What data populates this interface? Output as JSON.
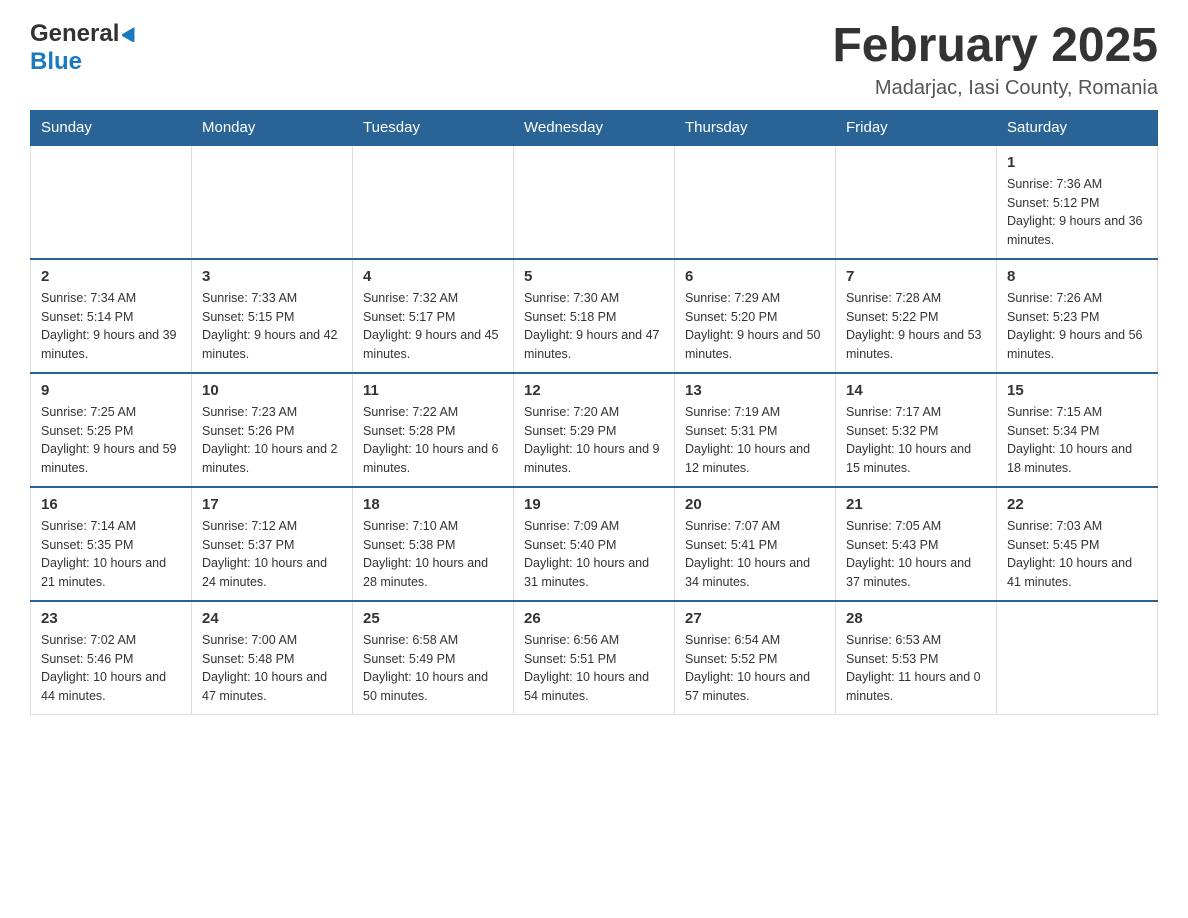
{
  "header": {
    "logo_general": "General",
    "logo_blue": "Blue",
    "month_title": "February 2025",
    "location": "Madarjac, Iasi County, Romania"
  },
  "weekdays": [
    "Sunday",
    "Monday",
    "Tuesday",
    "Wednesday",
    "Thursday",
    "Friday",
    "Saturday"
  ],
  "weeks": [
    [
      {
        "day": "",
        "sunrise": "",
        "sunset": "",
        "daylight": ""
      },
      {
        "day": "",
        "sunrise": "",
        "sunset": "",
        "daylight": ""
      },
      {
        "day": "",
        "sunrise": "",
        "sunset": "",
        "daylight": ""
      },
      {
        "day": "",
        "sunrise": "",
        "sunset": "",
        "daylight": ""
      },
      {
        "day": "",
        "sunrise": "",
        "sunset": "",
        "daylight": ""
      },
      {
        "day": "",
        "sunrise": "",
        "sunset": "",
        "daylight": ""
      },
      {
        "day": "1",
        "sunrise": "Sunrise: 7:36 AM",
        "sunset": "Sunset: 5:12 PM",
        "daylight": "Daylight: 9 hours and 36 minutes."
      }
    ],
    [
      {
        "day": "2",
        "sunrise": "Sunrise: 7:34 AM",
        "sunset": "Sunset: 5:14 PM",
        "daylight": "Daylight: 9 hours and 39 minutes."
      },
      {
        "day": "3",
        "sunrise": "Sunrise: 7:33 AM",
        "sunset": "Sunset: 5:15 PM",
        "daylight": "Daylight: 9 hours and 42 minutes."
      },
      {
        "day": "4",
        "sunrise": "Sunrise: 7:32 AM",
        "sunset": "Sunset: 5:17 PM",
        "daylight": "Daylight: 9 hours and 45 minutes."
      },
      {
        "day": "5",
        "sunrise": "Sunrise: 7:30 AM",
        "sunset": "Sunset: 5:18 PM",
        "daylight": "Daylight: 9 hours and 47 minutes."
      },
      {
        "day": "6",
        "sunrise": "Sunrise: 7:29 AM",
        "sunset": "Sunset: 5:20 PM",
        "daylight": "Daylight: 9 hours and 50 minutes."
      },
      {
        "day": "7",
        "sunrise": "Sunrise: 7:28 AM",
        "sunset": "Sunset: 5:22 PM",
        "daylight": "Daylight: 9 hours and 53 minutes."
      },
      {
        "day": "8",
        "sunrise": "Sunrise: 7:26 AM",
        "sunset": "Sunset: 5:23 PM",
        "daylight": "Daylight: 9 hours and 56 minutes."
      }
    ],
    [
      {
        "day": "9",
        "sunrise": "Sunrise: 7:25 AM",
        "sunset": "Sunset: 5:25 PM",
        "daylight": "Daylight: 9 hours and 59 minutes."
      },
      {
        "day": "10",
        "sunrise": "Sunrise: 7:23 AM",
        "sunset": "Sunset: 5:26 PM",
        "daylight": "Daylight: 10 hours and 2 minutes."
      },
      {
        "day": "11",
        "sunrise": "Sunrise: 7:22 AM",
        "sunset": "Sunset: 5:28 PM",
        "daylight": "Daylight: 10 hours and 6 minutes."
      },
      {
        "day": "12",
        "sunrise": "Sunrise: 7:20 AM",
        "sunset": "Sunset: 5:29 PM",
        "daylight": "Daylight: 10 hours and 9 minutes."
      },
      {
        "day": "13",
        "sunrise": "Sunrise: 7:19 AM",
        "sunset": "Sunset: 5:31 PM",
        "daylight": "Daylight: 10 hours and 12 minutes."
      },
      {
        "day": "14",
        "sunrise": "Sunrise: 7:17 AM",
        "sunset": "Sunset: 5:32 PM",
        "daylight": "Daylight: 10 hours and 15 minutes."
      },
      {
        "day": "15",
        "sunrise": "Sunrise: 7:15 AM",
        "sunset": "Sunset: 5:34 PM",
        "daylight": "Daylight: 10 hours and 18 minutes."
      }
    ],
    [
      {
        "day": "16",
        "sunrise": "Sunrise: 7:14 AM",
        "sunset": "Sunset: 5:35 PM",
        "daylight": "Daylight: 10 hours and 21 minutes."
      },
      {
        "day": "17",
        "sunrise": "Sunrise: 7:12 AM",
        "sunset": "Sunset: 5:37 PM",
        "daylight": "Daylight: 10 hours and 24 minutes."
      },
      {
        "day": "18",
        "sunrise": "Sunrise: 7:10 AM",
        "sunset": "Sunset: 5:38 PM",
        "daylight": "Daylight: 10 hours and 28 minutes."
      },
      {
        "day": "19",
        "sunrise": "Sunrise: 7:09 AM",
        "sunset": "Sunset: 5:40 PM",
        "daylight": "Daylight: 10 hours and 31 minutes."
      },
      {
        "day": "20",
        "sunrise": "Sunrise: 7:07 AM",
        "sunset": "Sunset: 5:41 PM",
        "daylight": "Daylight: 10 hours and 34 minutes."
      },
      {
        "day": "21",
        "sunrise": "Sunrise: 7:05 AM",
        "sunset": "Sunset: 5:43 PM",
        "daylight": "Daylight: 10 hours and 37 minutes."
      },
      {
        "day": "22",
        "sunrise": "Sunrise: 7:03 AM",
        "sunset": "Sunset: 5:45 PM",
        "daylight": "Daylight: 10 hours and 41 minutes."
      }
    ],
    [
      {
        "day": "23",
        "sunrise": "Sunrise: 7:02 AM",
        "sunset": "Sunset: 5:46 PM",
        "daylight": "Daylight: 10 hours and 44 minutes."
      },
      {
        "day": "24",
        "sunrise": "Sunrise: 7:00 AM",
        "sunset": "Sunset: 5:48 PM",
        "daylight": "Daylight: 10 hours and 47 minutes."
      },
      {
        "day": "25",
        "sunrise": "Sunrise: 6:58 AM",
        "sunset": "Sunset: 5:49 PM",
        "daylight": "Daylight: 10 hours and 50 minutes."
      },
      {
        "day": "26",
        "sunrise": "Sunrise: 6:56 AM",
        "sunset": "Sunset: 5:51 PM",
        "daylight": "Daylight: 10 hours and 54 minutes."
      },
      {
        "day": "27",
        "sunrise": "Sunrise: 6:54 AM",
        "sunset": "Sunset: 5:52 PM",
        "daylight": "Daylight: 10 hours and 57 minutes."
      },
      {
        "day": "28",
        "sunrise": "Sunrise: 6:53 AM",
        "sunset": "Sunset: 5:53 PM",
        "daylight": "Daylight: 11 hours and 0 minutes."
      },
      {
        "day": "",
        "sunrise": "",
        "sunset": "",
        "daylight": ""
      }
    ]
  ]
}
